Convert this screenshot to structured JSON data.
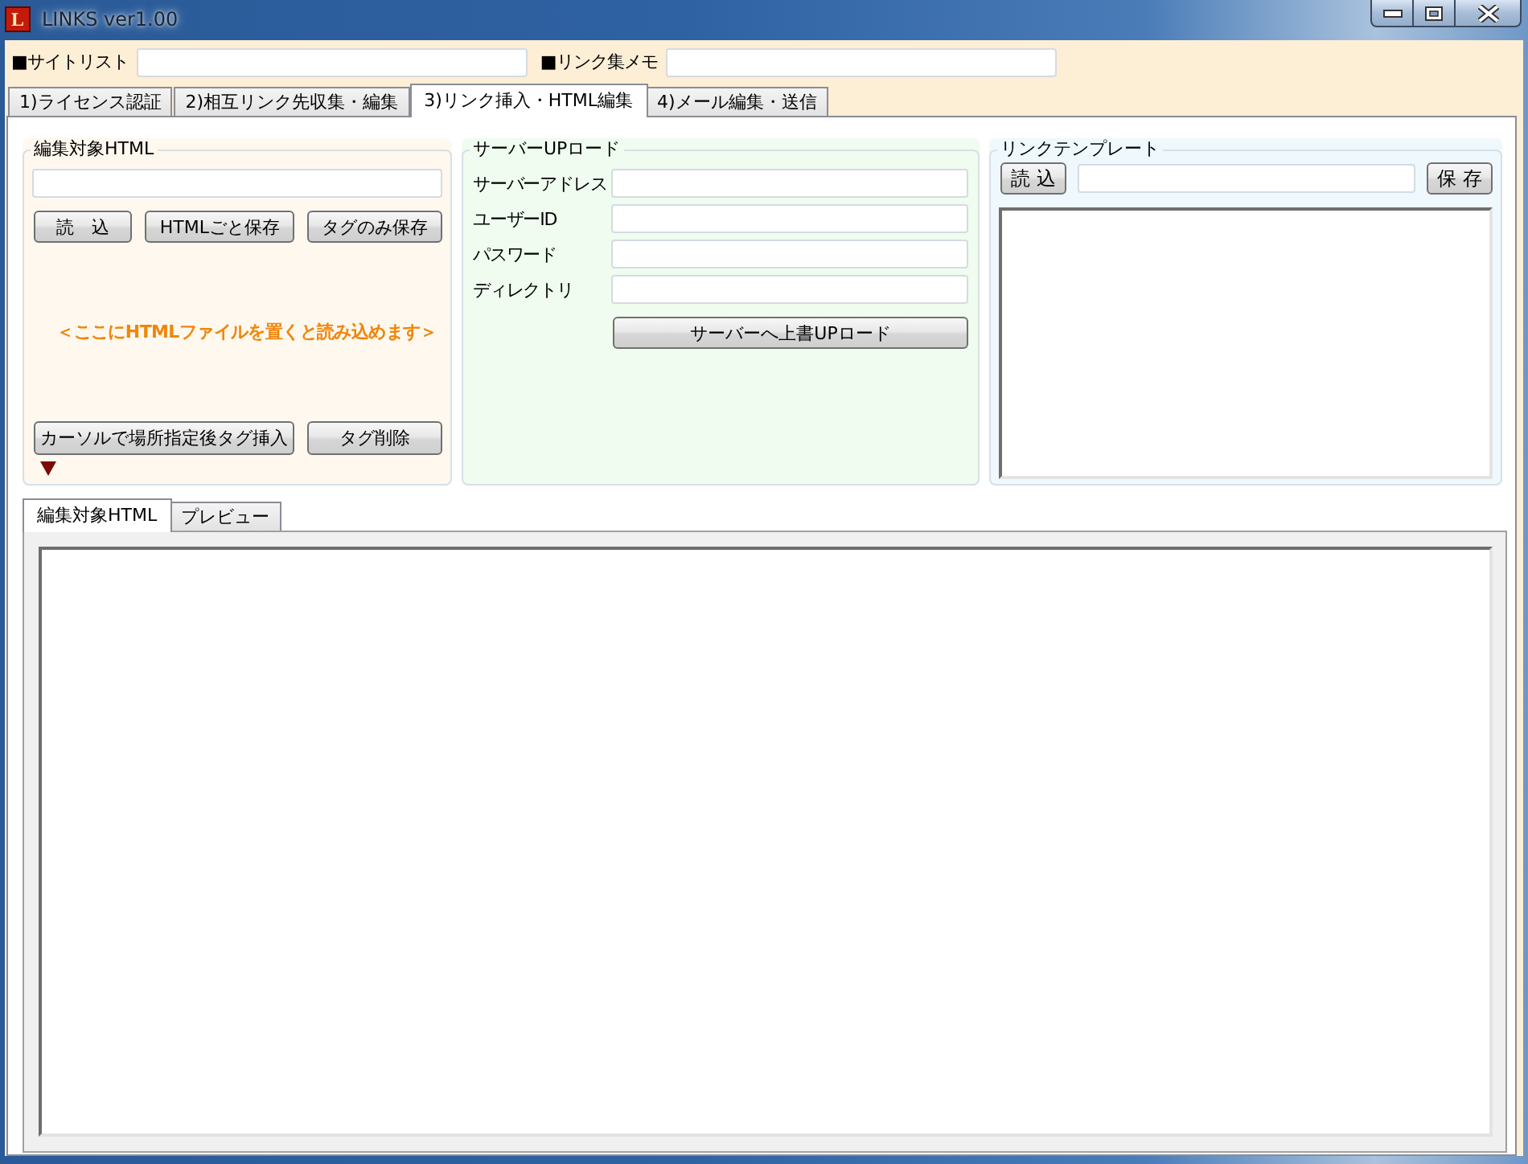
{
  "window": {
    "title": "LINKS ver1.00",
    "icon_letter": "L"
  },
  "top_fields": [
    {
      "label": "■サイトリスト"
    },
    {
      "label": "■リンク集メモ"
    }
  ],
  "tabs": [
    {
      "label": "1)ライセンス認証",
      "selected": false
    },
    {
      "label": "2)相互リンク先収集・編集",
      "selected": false
    },
    {
      "label": "3)リンク挿入・HTML編集",
      "selected": true
    },
    {
      "label": "4)メール編集・送信",
      "selected": false
    }
  ],
  "html_group": {
    "title": "編集対象HTML",
    "buttons": [
      "読　込",
      "HTMLごと保存",
      "タグのみ保存"
    ],
    "drop_hint": "＜ここにHTMLファイルを置くと読み込めます＞",
    "bottom_buttons": [
      "カーソルで場所指定後タグ挿入",
      "タグ削除"
    ]
  },
  "upload_group": {
    "title": "サーバーUPロード",
    "fields": [
      {
        "label": "サーバーアドレス"
      },
      {
        "label": "ユーザーID"
      },
      {
        "label": "パスワード"
      },
      {
        "label": "ディレクトリ"
      }
    ],
    "button": "サーバーへ上書UPロード"
  },
  "template_group": {
    "title": "リンクテンプレート",
    "load_button": "読 込",
    "save_button": "保 存"
  },
  "editor_tabs": [
    {
      "label": "編集対象HTML",
      "selected": true
    },
    {
      "label": "プレビュー",
      "selected": false
    }
  ]
}
